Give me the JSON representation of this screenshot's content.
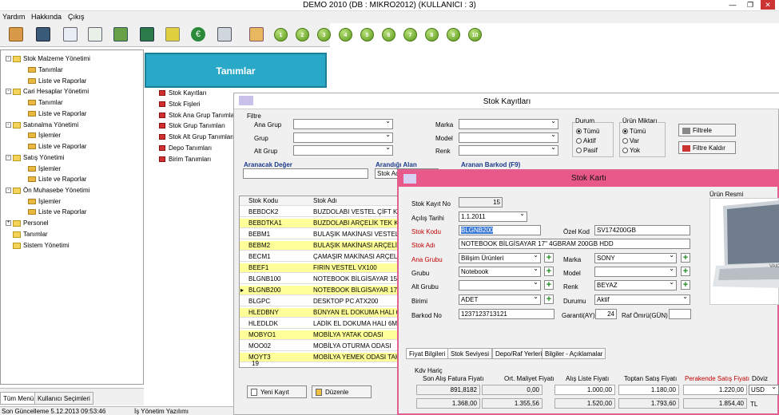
{
  "app": {
    "title": "DEMO 2010 (DB : MIKRO2012) (KULLANICI : 3)",
    "menu": [
      "Yardım",
      "Hakkında",
      "Çıkış"
    ],
    "numbers": [
      "1",
      "2",
      "3",
      "4",
      "5",
      "6",
      "7",
      "8",
      "9",
      "10"
    ]
  },
  "tree": {
    "items": [
      {
        "label": "Stok Malzeme Yönetimi"
      },
      {
        "label": "Tanımlar"
      },
      {
        "label": "Liste ve Raporlar"
      },
      {
        "label": "Cari Hesaplar Yönetimi"
      },
      {
        "label": "Tanımlar"
      },
      {
        "label": "Liste ve Raporlar"
      },
      {
        "label": "Satınalma Yönetimi"
      },
      {
        "label": "İşlemler"
      },
      {
        "label": "Liste ve Raporlar"
      },
      {
        "label": "Satış Yönetimi"
      },
      {
        "label": "İşlemler"
      },
      {
        "label": "Liste ve Raporlar"
      },
      {
        "label": "Ön Muhasebe Yönetimi"
      },
      {
        "label": "İşlemler"
      },
      {
        "label": "Liste ve Raporlar"
      },
      {
        "label": "Personel"
      },
      {
        "label": "Tanımlar"
      },
      {
        "label": "Sistem Yönetimi"
      }
    ],
    "bottom_tabs": [
      "Tüm Menü",
      "Kullanıcı Seçimleri"
    ]
  },
  "status": {
    "updated": "Son Güncelleme 5.12.2013 09:53:46",
    "module": "İş Yönetim Yazılımı"
  },
  "tanimlar": {
    "title": "Tanımlar",
    "items": [
      "Stok Kayıtları",
      "Stok Fişleri",
      "Stok Ana Grup Tanımları",
      "Stok Grup Tanımları",
      "Stok Alt Grup Tanımları",
      "Depo Tanımları",
      "Birim Tanımları"
    ]
  },
  "stok_kayitlari": {
    "title": "Stok Kayıtları",
    "filtre": "Filtre",
    "filters_left": [
      "Ana Grup",
      "Grup",
      "Alt Grup"
    ],
    "filters_mid": [
      "Marka",
      "Model",
      "Renk"
    ],
    "durum": {
      "title": "Durum",
      "options": [
        "Tümü",
        "Aktif",
        "Pasif"
      ]
    },
    "miktar": {
      "title": "Ürün Miktarı",
      "options": [
        "Tümü",
        "Var",
        "Yok"
      ]
    },
    "filtrele": "Filtrele",
    "filtre_kaldir": "Filtre Kaldır",
    "aranacak_deger": "Aranacak Değer",
    "arandigi_alan": "Arandığı Alan",
    "arandigi_alan_value": "Stok Ad",
    "aranan_barkod": "Aranan Barkod (F9)",
    "columns": [
      "Stok Kodu",
      "Stok Adı"
    ],
    "rows": [
      {
        "code": "BEBDCK2",
        "name": "BUZDOLABI VESTEL ÇİFT KA"
      },
      {
        "code": "BEBDTKA1",
        "name": "BUZDOLABI ARÇELİK TEK KAPI"
      },
      {
        "code": "BEBM1",
        "name": "BULAŞIK MAKİNASI VESTEL"
      },
      {
        "code": "BEBM2",
        "name": "BULAŞIK MAKİNASI ARÇELİK R"
      },
      {
        "code": "BECM1",
        "name": "ÇAMAŞIR MAKİNASI ARÇELİK"
      },
      {
        "code": "BEEF1",
        "name": "FIRIN VESTEL VX100"
      },
      {
        "code": "BLGNB100",
        "name": "NOTEBOOK BİLGİSAYAR 15\""
      },
      {
        "code": "BLGNB200",
        "name": "NOTEBOOK BİLGİSAYAR 17\" 4"
      },
      {
        "code": "BLGPC",
        "name": "DESKTOP PC ATX200"
      },
      {
        "code": "HLEDBNY",
        "name": "BÜNYAN EL DOKUMA HALI 6M2"
      },
      {
        "code": "HLEDLDK",
        "name": "LADİK EL DOKUMA HALI 6M2"
      },
      {
        "code": "MOBYO1",
        "name": "MOBİLYA YATAK ODASI"
      },
      {
        "code": "MOO02",
        "name": "MOBİLYA OTURMA ODASI"
      },
      {
        "code": "MOYT3",
        "name": "MOBİLYA YEMEK ODASI TAKIM"
      }
    ],
    "count": "19",
    "yeni_kayit": "Yeni Kayıt",
    "duzenle": "Düzenle"
  },
  "stok_karti": {
    "title": "Stok Kartı",
    "kayit_no_label": "Stok Kayıt No",
    "kayit_no": "15",
    "acilis_label": "Açılış Tarihi",
    "acilis": "1.1.2011",
    "kodu_label": "Stok Kodu",
    "kodu": "BLGNB200",
    "ozel_kod_label": "Özel Kod",
    "ozel_kod": "SV174200GB",
    "adi_label": "Stok Adı",
    "adi": "NOTEBOOK BİLGİSAYAR 17\" 4GBRAM 200GB HDD",
    "ana_grup_label": "Ana Grubu",
    "ana_grup": "Bilişim Ürünleri",
    "grubu_label": "Grubu",
    "grubu": "Notebook",
    "alt_grubu_label": "Alt Grubu",
    "alt_grubu": "",
    "birimi_label": "Birimi",
    "birimi": "ADET",
    "barkod_label": "Barkod No",
    "barkod": "1237123713121",
    "marka_label": "Marka",
    "marka": "SONY",
    "model_label": "Model",
    "model": "",
    "renk_label": "Renk",
    "renk": "BEYAZ",
    "durumu_label": "Durumu",
    "durumu": "Aktif",
    "garanti_label": "Garanti(AY)",
    "garanti": "24",
    "raf_label": "Raf Ömrü(GÜN)",
    "raf": "",
    "urun_resmi": "Ürün Resmi",
    "tabs": [
      "Fiyat Bilgileri",
      "Stok Seviyesi",
      "Depo/Raf Yerleri",
      "Bilgiler - Açıklamalar"
    ],
    "kdv_haric": "Kdv Hariç",
    "price_headers": [
      "Son Alış Fatura Fiyatı",
      "Ort. Maliyet Fiyatı",
      "Alış Liste Fiyatı",
      "Toptan Satış Fiyatı",
      "Perakende Satış Fiyatı",
      "Döviz"
    ],
    "row1": [
      "891,8182",
      "0,00",
      "1.000,00",
      "1.180,00",
      "1.220,00",
      "USD"
    ],
    "row2": [
      "1.368,00",
      "1.355,56",
      "1.520,00",
      "1.793,60",
      "1.854,40",
      "TL"
    ]
  },
  "colors": {
    "accent_blue": "#2aa8c8",
    "stok_karti_pink": "#e85888",
    "row_yellow": "#ffff99"
  }
}
